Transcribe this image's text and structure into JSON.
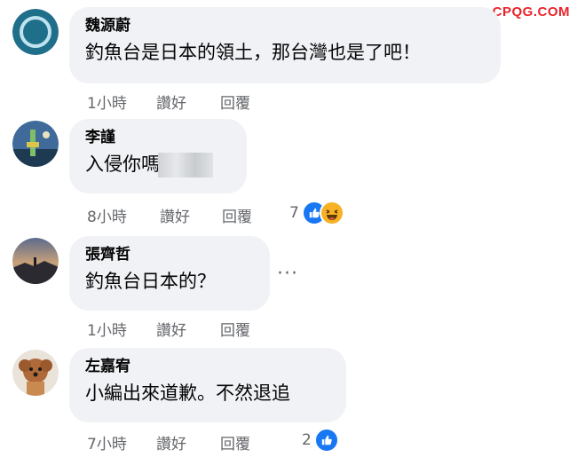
{
  "watermark": "CPQG.COM",
  "comments": [
    {
      "author": "魏源蔚",
      "text": "釣魚台是日本的領土，那台灣也是了吧！",
      "time": "1小時",
      "like_label": "讚好",
      "reply_label": "回覆"
    },
    {
      "author": "李謹",
      "text": "入侵你嗎",
      "time": "8小時",
      "like_label": "讚好",
      "reply_label": "回覆",
      "reaction_count": "7"
    },
    {
      "author": "張齊哲",
      "text": "釣魚台日本的？",
      "time": "1小時",
      "like_label": "讚好",
      "reply_label": "回覆",
      "more": "···"
    },
    {
      "author": "左嘉宥",
      "text": "小編出來道歉。不然退追",
      "time": "7小時",
      "like_label": "讚好",
      "reply_label": "回覆",
      "reaction_count": "2"
    }
  ],
  "colors": {
    "bubble": "#f0f2f5",
    "meta_text": "#65676b",
    "like_blue": "#1877f2",
    "haha_yellow": "#f7b125",
    "watermark_red": "#e8232a"
  }
}
